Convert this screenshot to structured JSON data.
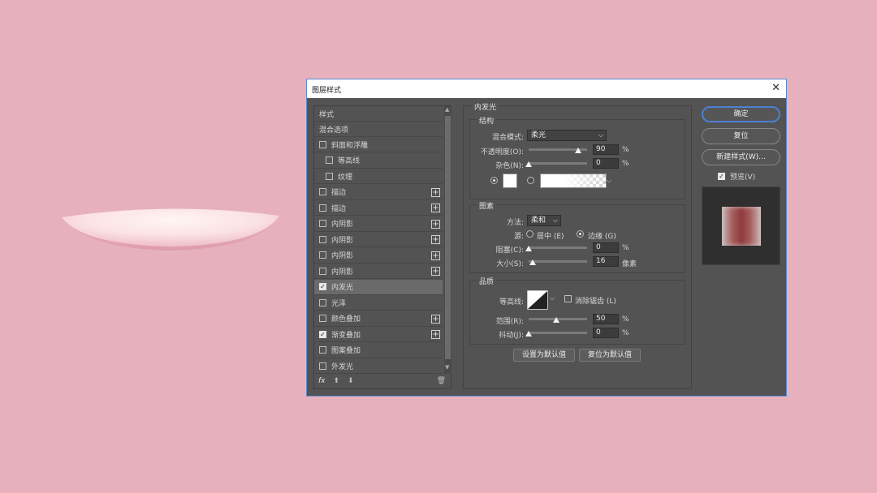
{
  "dialog": {
    "title": "图层样式",
    "close_label": "✕"
  },
  "styles_list": {
    "header": "样式",
    "blend_options": "混合选项",
    "items": [
      {
        "label": "斜面和浮雕",
        "checked": false,
        "plus": false,
        "indent": false
      },
      {
        "label": "等高线",
        "checked": false,
        "plus": false,
        "indent": true
      },
      {
        "label": "纹理",
        "checked": false,
        "plus": false,
        "indent": true
      },
      {
        "label": "描边",
        "checked": false,
        "plus": true,
        "indent": false
      },
      {
        "label": "描边",
        "checked": false,
        "plus": true,
        "indent": false
      },
      {
        "label": "内阴影",
        "checked": false,
        "plus": true,
        "indent": false
      },
      {
        "label": "内阴影",
        "checked": false,
        "plus": true,
        "indent": false
      },
      {
        "label": "内阴影",
        "checked": false,
        "plus": true,
        "indent": false
      },
      {
        "label": "内阴影",
        "checked": false,
        "plus": true,
        "indent": false
      },
      {
        "label": "内发光",
        "checked": true,
        "plus": false,
        "indent": false,
        "selected": true
      },
      {
        "label": "光泽",
        "checked": false,
        "plus": false,
        "indent": false
      },
      {
        "label": "颜色叠加",
        "checked": false,
        "plus": true,
        "indent": false
      },
      {
        "label": "渐变叠加",
        "checked": true,
        "plus": true,
        "indent": false
      },
      {
        "label": "图案叠加",
        "checked": false,
        "plus": false,
        "indent": false
      },
      {
        "label": "外发光",
        "checked": false,
        "plus": false,
        "indent": false
      }
    ],
    "fx_label": "fx"
  },
  "inner_glow": {
    "title": "内发光",
    "structure": {
      "title": "结构",
      "blend_mode_label": "混合模式:",
      "blend_mode_value": "柔光",
      "opacity_label": "不透明度(O):",
      "opacity_value": "90",
      "opacity_unit": "%",
      "opacity_fraction": 0.9,
      "noise_label": "杂色(N):",
      "noise_value": "0",
      "noise_unit": "%",
      "noise_fraction": 0.0
    },
    "elements": {
      "title": "图素",
      "method_label": "方法:",
      "method_value": "柔和",
      "source_label": "源:",
      "source_center": "居中 (E)",
      "source_edge": "边缘 (G)",
      "choke_label": "阻塞(C):",
      "choke_value": "0",
      "choke_unit": "%",
      "choke_fraction": 0.0,
      "size_label": "大小(S):",
      "size_value": "16",
      "size_unit": "像素",
      "size_fraction": 0.08
    },
    "quality": {
      "title": "品质",
      "contour_label": "等高线:",
      "antialias_label": "消除锯齿 (L)",
      "range_label": "范围(R):",
      "range_value": "50",
      "range_unit": "%",
      "range_fraction": 0.5,
      "jitter_label": "抖动(J):",
      "jitter_value": "0",
      "jitter_unit": "%",
      "jitter_fraction": 0.0
    },
    "make_default": "设置为默认值",
    "reset_default": "复位为默认值"
  },
  "actions": {
    "ok": "确定",
    "reset": "复位",
    "new_style": "新建样式(W)...",
    "preview_label": "预览(V)",
    "preview_checked": true
  },
  "colors": {
    "background": "#e6b1bd",
    "dialog_bg": "#535353",
    "accent": "#4e7fd4"
  }
}
